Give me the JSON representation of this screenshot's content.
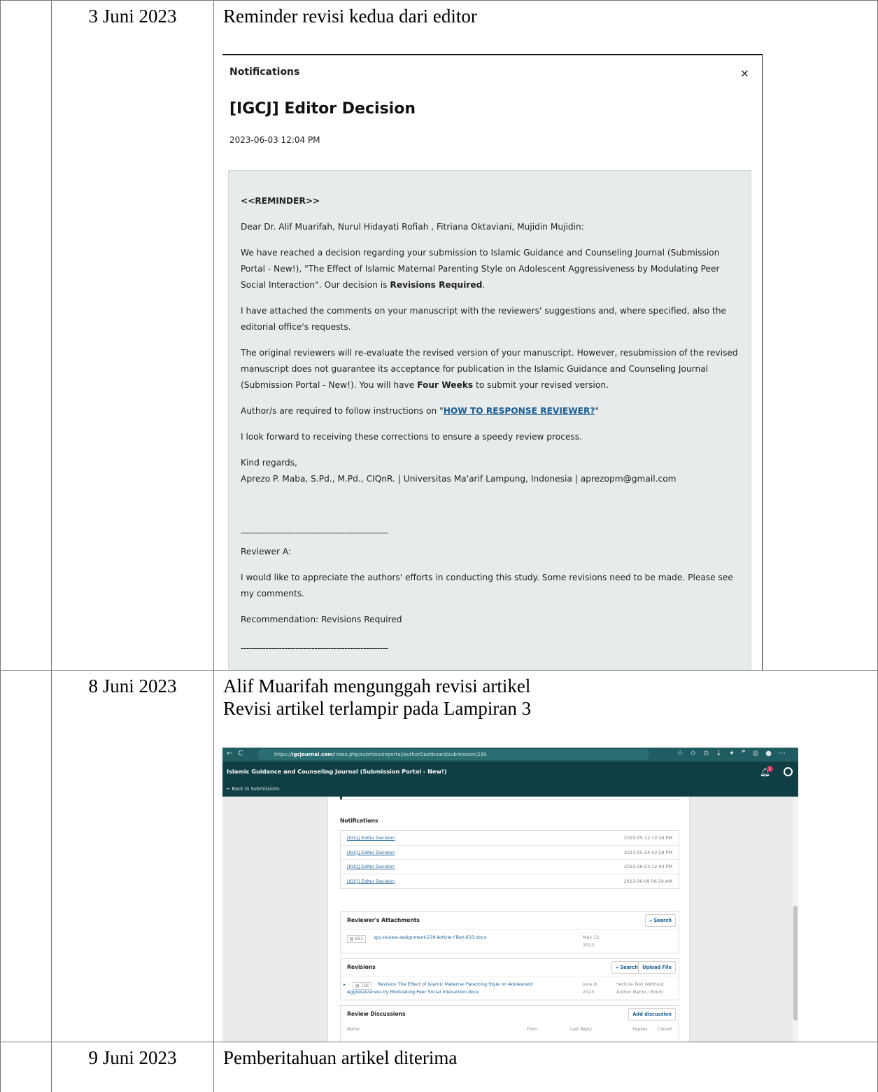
{
  "rows": [
    {
      "date": "3 Juni 2023",
      "description": "Reminder revisi kedua dari editor"
    },
    {
      "date": "8 Juni 2023",
      "description_lines": [
        "Alif Muarifah mengunggah revisi artikel",
        "Revisi artikel terlampir pada Lampiran 3"
      ]
    },
    {
      "date": "9 Juni 2023",
      "description": "Pemberitahuan artikel diterima"
    }
  ],
  "notification": {
    "header": "Notifications",
    "close": "×",
    "title": "[IGCJ] Editor Decision",
    "datetime": "2023-06-03 12:04 PM",
    "reminder": "<<REMINDER>>",
    "salutation": "Dear Dr. Alif Muarifah, Nurul Hidayati Rofiah , Fitriana Oktaviani, Mujidin Mujidin:",
    "p1_start": "We have reached a decision regarding your submission to Islamic Guidance and Counseling Journal (Submission Portal - New!), \"The Effect of Islamic Maternal Parenting Style on Adolescent Aggressiveness by Modulating Peer Social Interaction\". Our decision is ",
    "p1_decision": "Revisions Required",
    "p1_end": ".",
    "p2": "I have attached the comments on your manuscript with the reviewers' suggestions and, where specified, also the editorial office's requests.",
    "p3_start": "The original reviewers will re-evaluate the revised version of your manuscript. However, resubmission of the revised manuscript does not guarantee its acceptance for publication in the Islamic Guidance and Counseling Journal (Submission Portal - New!). You will have ",
    "p3_bold": "Four Weeks",
    "p3_end": " to submit your revised version.",
    "p4_start": "Author/s are required to follow instructions on \"",
    "p4_link": "HOW TO RESPONSE REVIEWER?",
    "p4_end": "\"",
    "p5": "I look forward to receiving these corrections to ensure a speedy review process.",
    "regards": "Kind regards,",
    "signature": "Aprezo P. Maba, S.Pd., M.Pd., CIQnR. | Universitas Ma'arif Lampung, Indonesia | aprezopm@gmail.com",
    "separator": "------------------------------------------------------",
    "reviewer_label": "Reviewer A:",
    "reviewer_comment": "I would like to appreciate the authors' efforts in conducting this study. Some revisions need to be made. Please see my comments.",
    "recommendation": "Recommendation: Revisions Required"
  },
  "browser": {
    "url_prefix": "https://",
    "url_domain": "igcjournal.com",
    "url_path": "/index.php/submissionportal/authorDashboard/submission/239",
    "app_title": "Islamic Guidance and Counseling Journal (Submission Portal - New!)",
    "back_link": "← Back to Submissions",
    "bell_count": "1",
    "notifications_title": "Notifications",
    "notifications": [
      {
        "title": "[IGCJ] Editor Decision",
        "date": "2023-05-12 12:26 PM"
      },
      {
        "title": "[IGCJ] Editor Decision",
        "date": "2023-05-24 02:58 PM"
      },
      {
        "title": "[IGCJ] Editor Decision",
        "date": "2023-06-03 12:04 PM"
      },
      {
        "title": "[IGCJ] Editor Decision",
        "date": "2023-06-09 06:24 AM"
      }
    ],
    "reviewer_attachments": {
      "title": "Reviewer's Attachments",
      "search": "Search",
      "file_id": "651",
      "file_name": "igcj-review-assignment-239-Article+Text-633.docx",
      "file_date_1": "May 12,",
      "file_date_2": "2023"
    },
    "revisions": {
      "title": "Revisions",
      "search": "Search",
      "upload": "Upload File",
      "file_id": "726",
      "file_name_1": "Revision The Effect of Islamic Maternal Parenting Style on Adolescent",
      "file_name_2": "Aggressiveness by Modulating Peer Social Interaction.docx",
      "file_date_1": "June 8,",
      "file_date_2": "2023",
      "file_type_1": "*Article Text (Without",
      "file_type_2": "Author Name / Blind)"
    },
    "review_discussions": {
      "title": "Review Discussions",
      "add": "Add discussion",
      "columns": [
        "Name",
        "From",
        "Last Reply",
        "Replies",
        "Closed"
      ]
    }
  }
}
